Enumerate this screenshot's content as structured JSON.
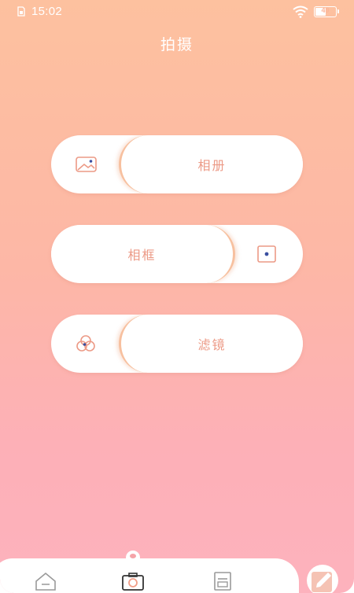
{
  "status_bar": {
    "time": "15:02",
    "battery": "49"
  },
  "header": {
    "title": "拍摄"
  },
  "options": [
    {
      "label": "相册",
      "icon": "image-icon"
    },
    {
      "label": "相框",
      "icon": "frame-icon"
    },
    {
      "label": "滤镜",
      "icon": "filter-icon"
    }
  ],
  "tabbar": {
    "items": [
      {
        "icon": "home-icon",
        "active": false
      },
      {
        "icon": "camera-icon",
        "active": true
      },
      {
        "icon": "document-icon",
        "active": false
      }
    ],
    "fab_icon": "edit-icon"
  },
  "colors": {
    "accent": "#ec9a86",
    "gradient_top": "#fdc19f",
    "gradient_bottom": "#fdb2bd",
    "icon_dot": "#3a4fa0"
  }
}
